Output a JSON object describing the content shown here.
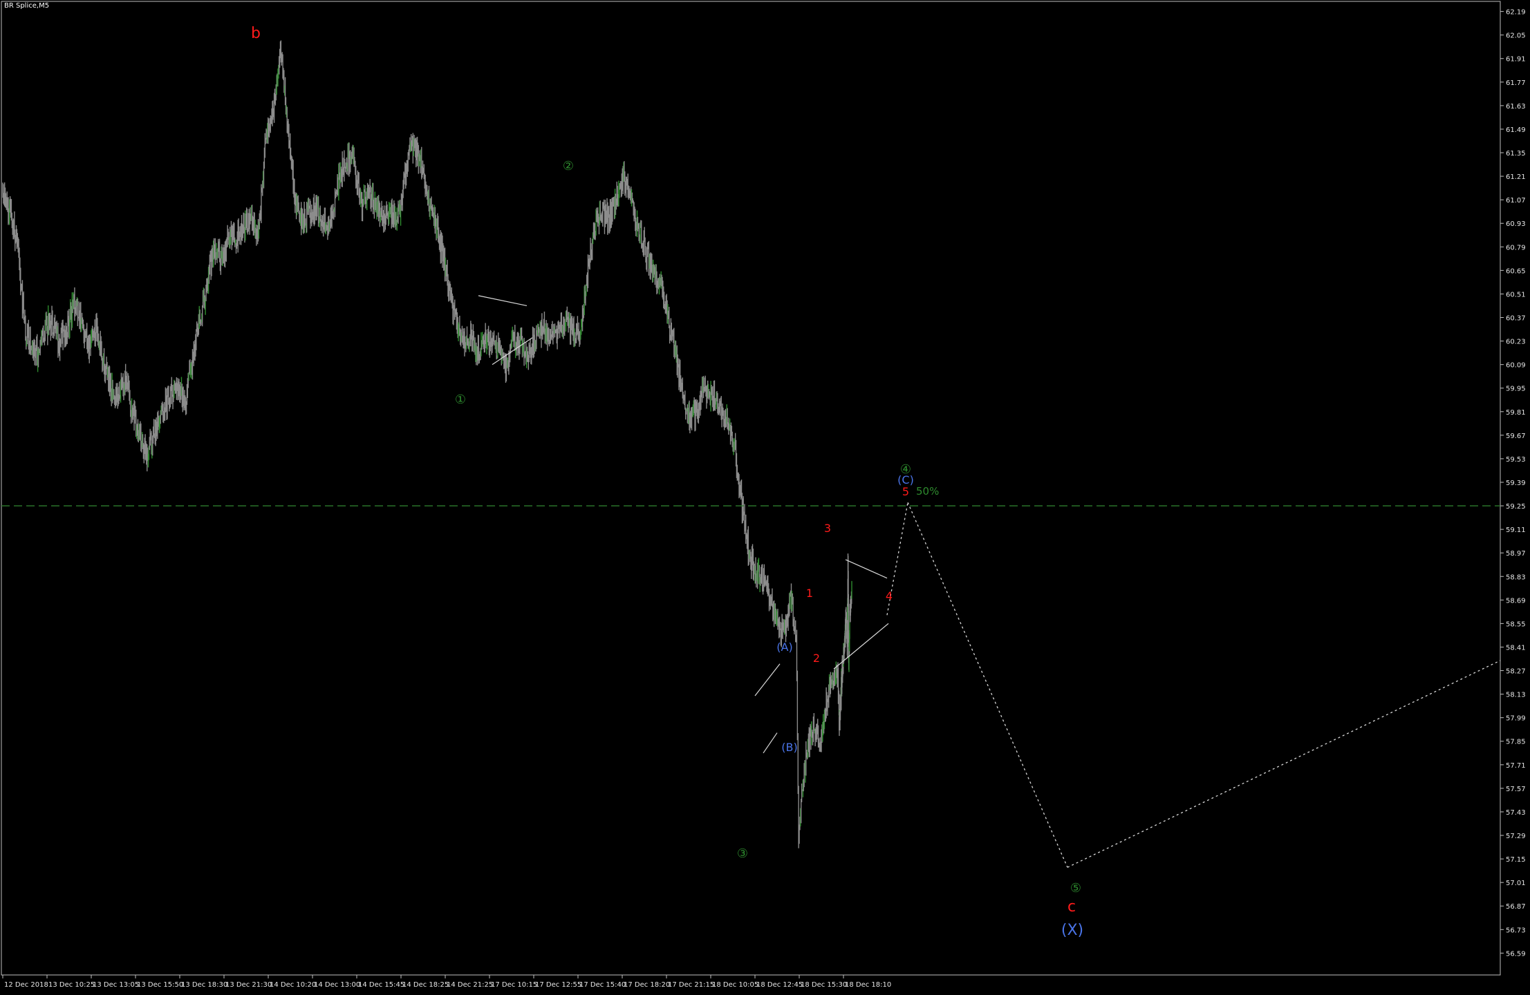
{
  "window": {
    "symbol_label": "BR Splice,M5"
  },
  "colors": {
    "background": "#000000",
    "frame": "#bfbfbf",
    "candle": "#8c8c8c",
    "bull_body": "#2e8b2e",
    "level_line": "#2e7d2e",
    "wave_green": "#2e8b2e",
    "wave_red": "#ff1a1a",
    "wave_blue": "#4a74e8",
    "projection": "#d9d9d9"
  },
  "chart_data": {
    "type": "line",
    "title": "",
    "xlabel": "",
    "ylabel": "",
    "ylim": [
      56.46,
      62.25
    ],
    "grid": false,
    "y_ticks": [
      "62.19",
      "62.05",
      "61.91",
      "61.77",
      "61.63",
      "61.49",
      "61.35",
      "61.21",
      "61.07",
      "60.93",
      "60.79",
      "60.65",
      "60.51",
      "60.37",
      "60.23",
      "60.09",
      "59.95",
      "59.81",
      "59.67",
      "59.53",
      "59.39",
      "59.25",
      "59.11",
      "58.97",
      "58.83",
      "58.69",
      "58.55",
      "58.41",
      "58.27",
      "58.13",
      "57.99",
      "57.85",
      "57.71",
      "57.57",
      "57.43",
      "57.29",
      "57.15",
      "57.01",
      "56.87",
      "56.73",
      "56.59"
    ],
    "x_ticks": [
      "12 Dec 2018",
      "13 Dec 10:25",
      "13 Dec 13:05",
      "13 Dec 15:50",
      "13 Dec 18:30",
      "13 Dec 21:30",
      "14 Dec 10:20",
      "14 Dec 13:00",
      "14 Dec 15:45",
      "14 Dec 18:25",
      "14 Dec 21:25",
      "17 Dec 10:15",
      "17 Dec 12:55",
      "17 Dec 15:40",
      "17 Dec 18:20",
      "17 Dec 21:15",
      "18 Dec 10:05",
      "18 Dec 12:45",
      "18 Dec 15:30",
      "18 Dec 18:10"
    ],
    "x_index_range": [
      0,
      340
    ],
    "price_path": [
      [
        0,
        61.1
      ],
      [
        3,
        61.0
      ],
      [
        6,
        60.8
      ],
      [
        9,
        60.3
      ],
      [
        12,
        60.2
      ],
      [
        14,
        60.15
      ],
      [
        17,
        60.3
      ],
      [
        20,
        60.35
      ],
      [
        23,
        60.22
      ],
      [
        26,
        60.3
      ],
      [
        29,
        60.45
      ],
      [
        32,
        60.35
      ],
      [
        35,
        60.2
      ],
      [
        38,
        60.3
      ],
      [
        41,
        60.1
      ],
      [
        44,
        59.95
      ],
      [
        47,
        59.9
      ],
      [
        50,
        60.0
      ],
      [
        53,
        59.8
      ],
      [
        56,
        59.65
      ],
      [
        59,
        59.55
      ],
      [
        62,
        59.7
      ],
      [
        65,
        59.8
      ],
      [
        68,
        59.9
      ],
      [
        71,
        60.0
      ],
      [
        74,
        59.85
      ],
      [
        77,
        60.1
      ],
      [
        80,
        60.35
      ],
      [
        83,
        60.55
      ],
      [
        86,
        60.8
      ],
      [
        89,
        60.7
      ],
      [
        92,
        60.85
      ],
      [
        95,
        60.85
      ],
      [
        98,
        60.9
      ],
      [
        101,
        60.95
      ],
      [
        104,
        60.85
      ],
      [
        107,
        61.4
      ],
      [
        110,
        61.6
      ],
      [
        113,
        61.95
      ],
      [
        116,
        61.5
      ],
      [
        119,
        61.05
      ],
      [
        122,
        60.95
      ],
      [
        125,
        61.0
      ],
      [
        128,
        61.0
      ],
      [
        131,
        60.95
      ],
      [
        134,
        60.95
      ],
      [
        137,
        61.2
      ],
      [
        140,
        61.3
      ],
      [
        143,
        61.3
      ],
      [
        146,
        61.05
      ],
      [
        149,
        61.1
      ],
      [
        152,
        61.05
      ],
      [
        155,
        60.95
      ],
      [
        158,
        61.0
      ],
      [
        161,
        60.95
      ],
      [
        164,
        61.25
      ],
      [
        167,
        61.4
      ],
      [
        170,
        61.3
      ],
      [
        173,
        61.1
      ],
      [
        176,
        60.95
      ],
      [
        179,
        60.75
      ],
      [
        182,
        60.5
      ],
      [
        185,
        60.35
      ],
      [
        188,
        60.2
      ],
      [
        191,
        60.25
      ],
      [
        194,
        60.15
      ],
      [
        197,
        60.25
      ],
      [
        200,
        60.2
      ],
      [
        203,
        60.15
      ],
      [
        205,
        60.05
      ],
      [
        208,
        60.25
      ],
      [
        211,
        60.2
      ],
      [
        214,
        60.15
      ],
      [
        217,
        60.25
      ],
      [
        220,
        60.3
      ],
      [
        223,
        60.25
      ],
      [
        226,
        60.3
      ],
      [
        229,
        60.35
      ],
      [
        232,
        60.3
      ],
      [
        235,
        60.25
      ],
      [
        238,
        60.65
      ],
      [
        241,
        60.9
      ],
      [
        244,
        61.0
      ],
      [
        247,
        60.95
      ],
      [
        250,
        61.1
      ],
      [
        253,
        61.2
      ],
      [
        256,
        61.05
      ],
      [
        259,
        60.9
      ],
      [
        262,
        60.75
      ],
      [
        265,
        60.65
      ],
      [
        268,
        60.55
      ],
      [
        271,
        60.35
      ],
      [
        274,
        60.15
      ],
      [
        277,
        59.9
      ],
      [
        280,
        59.75
      ],
      [
        283,
        59.85
      ],
      [
        286,
        59.95
      ],
      [
        289,
        59.9
      ],
      [
        292,
        59.85
      ],
      [
        295,
        59.75
      ],
      [
        298,
        59.6
      ],
      [
        301,
        59.25
      ],
      [
        304,
        58.95
      ],
      [
        307,
        58.85
      ],
      [
        310,
        58.8
      ],
      [
        313,
        58.65
      ],
      [
        316,
        58.5
      ],
      [
        319,
        58.55
      ],
      [
        321,
        58.7
      ],
      [
        323,
        58.45
      ],
      [
        324,
        57.3
      ],
      [
        325,
        57.5
      ],
      [
        327,
        57.75
      ],
      [
        330,
        57.95
      ],
      [
        333,
        57.85
      ],
      [
        336,
        58.15
      ],
      [
        339,
        58.25
      ]
    ],
    "price_path_tail": [
      [
        0,
        58.25
      ],
      [
        4,
        57.95
      ],
      [
        8,
        58.1
      ],
      [
        12,
        58.25
      ],
      [
        16,
        58.35
      ],
      [
        20,
        58.45
      ],
      [
        24,
        58.6
      ],
      [
        27,
        58.45
      ],
      [
        29,
        59.0
      ],
      [
        31,
        58.3
      ],
      [
        34,
        58.55
      ],
      [
        37,
        58.65
      ],
      [
        40,
        58.8
      ]
    ],
    "levels": [
      {
        "price": 59.25,
        "label": "50%"
      }
    ],
    "wave_labels": [
      {
        "text": "b",
        "style": "big-red"
      },
      {
        "text": "①",
        "style": "green"
      },
      {
        "text": "②",
        "style": "green"
      },
      {
        "text": "③",
        "style": "green"
      },
      {
        "text": "④",
        "style": "green"
      },
      {
        "text": "⑤",
        "style": "green"
      },
      {
        "text": "(A)",
        "style": "blue"
      },
      {
        "text": "(B)",
        "style": "blue"
      },
      {
        "text": "(C)",
        "style": "blue"
      },
      {
        "text": "1",
        "style": "red"
      },
      {
        "text": "2",
        "style": "red"
      },
      {
        "text": "3",
        "style": "red"
      },
      {
        "text": "4",
        "style": "red"
      },
      {
        "text": "5",
        "style": "red"
      },
      {
        "text": "c",
        "style": "big-red"
      },
      {
        "text": "(X)",
        "style": "big-blue"
      }
    ],
    "projection_path": [
      {
        "label": "4",
        "price": 58.6
      },
      {
        "label": "5",
        "price": 59.27
      },
      {
        "label": "⑤",
        "price": 57.1
      },
      {
        "label": "end",
        "price": 58.33
      }
    ]
  }
}
